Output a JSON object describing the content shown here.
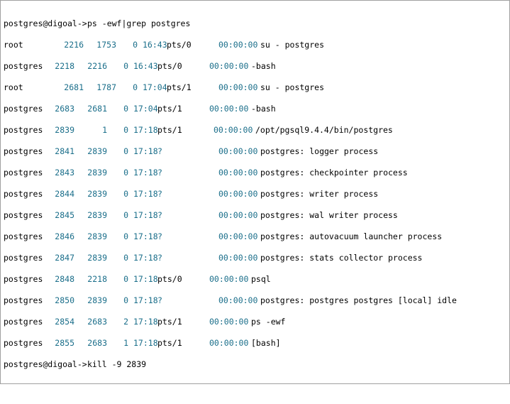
{
  "terminal": {
    "commands": [
      {
        "prompt": "postgres@digoal->",
        "command": "ps -ewf|grep postgres"
      },
      {
        "prompt": "postgres@digoal->",
        "command": "kill -9 2839"
      }
    ],
    "rows": [
      {
        "user": "root",
        "pid": "2216",
        "ppid": "1753",
        "c": "0",
        "stime": "16:43",
        "tty": "pts/0",
        "time": "00:00:00",
        "cmd": "su - postgres"
      },
      {
        "user": "postgres",
        "pid": "2218",
        "ppid": "2216",
        "c": "0",
        "stime": "16:43",
        "tty": "pts/0",
        "time": "00:00:00",
        "cmd": "-bash"
      },
      {
        "user": "root",
        "pid": "2681",
        "ppid": "1787",
        "c": "0",
        "stime": "17:04",
        "tty": "pts/1",
        "time": "00:00:00",
        "cmd": "su - postgres"
      },
      {
        "user": "postgres",
        "pid": "2683",
        "ppid": "2681",
        "c": "0",
        "stime": "17:04",
        "tty": "pts/1",
        "time": "00:00:00",
        "cmd": "-bash"
      },
      {
        "user": "postgres",
        "pid": "2839",
        "ppid": "1",
        "c": "0",
        "stime": "17:18",
        "tty": "pts/1",
        "time": "00:00:00",
        "cmd": "/opt/pgsql9.4.4/bin/postgres"
      },
      {
        "user": "postgres",
        "pid": "2841",
        "ppid": "2839",
        "c": "0",
        "stime": "17:18",
        "tty": "?",
        "time": "00:00:00",
        "cmd": "postgres: logger process"
      },
      {
        "user": "postgres",
        "pid": "2843",
        "ppid": "2839",
        "c": "0",
        "stime": "17:18",
        "tty": "?",
        "time": "00:00:00",
        "cmd": "postgres: checkpointer process"
      },
      {
        "user": "postgres",
        "pid": "2844",
        "ppid": "2839",
        "c": "0",
        "stime": "17:18",
        "tty": "?",
        "time": "00:00:00",
        "cmd": "postgres: writer process"
      },
      {
        "user": "postgres",
        "pid": "2845",
        "ppid": "2839",
        "c": "0",
        "stime": "17:18",
        "tty": "?",
        "time": "00:00:00",
        "cmd": "postgres: wal writer process"
      },
      {
        "user": "postgres",
        "pid": "2846",
        "ppid": "2839",
        "c": "0",
        "stime": "17:18",
        "tty": "?",
        "time": "00:00:00",
        "cmd": "postgres: autovacuum launcher process"
      },
      {
        "user": "postgres",
        "pid": "2847",
        "ppid": "2839",
        "c": "0",
        "stime": "17:18",
        "tty": "?",
        "time": "00:00:00",
        "cmd": "postgres: stats collector process"
      },
      {
        "user": "postgres",
        "pid": "2848",
        "ppid": "2218",
        "c": "0",
        "stime": "17:18",
        "tty": "pts/0",
        "time": "00:00:00",
        "cmd": "psql"
      },
      {
        "user": "postgres",
        "pid": "2850",
        "ppid": "2839",
        "c": "0",
        "stime": "17:18",
        "tty": "?",
        "time": "00:00:00",
        "cmd": "postgres: postgres postgres [local] idle"
      },
      {
        "user": "postgres",
        "pid": "2854",
        "ppid": "2683",
        "c": "2",
        "stime": "17:18",
        "tty": "pts/1",
        "time": "00:00:00",
        "cmd": "ps -ewf"
      },
      {
        "user": "postgres",
        "pid": "2855",
        "ppid": "2683",
        "c": "1",
        "stime": "17:18",
        "tty": "pts/1",
        "time": "00:00:00",
        "cmd": "[bash]"
      }
    ]
  },
  "colors": {
    "background": "#ffffff",
    "text": "#000000",
    "number": "#1a6e8a",
    "border": "#a0a0a0"
  }
}
